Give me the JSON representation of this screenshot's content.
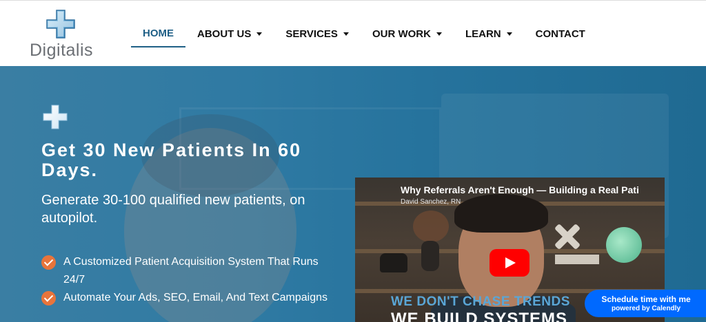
{
  "brand": {
    "name": "Digitalis",
    "accent": "#1e5f86",
    "cross_color": "#6fb2e0"
  },
  "nav": {
    "items": [
      {
        "label": "HOME",
        "active": true,
        "has_dropdown": false
      },
      {
        "label": "ABOUT US",
        "active": false,
        "has_dropdown": true
      },
      {
        "label": "SERVICES",
        "active": false,
        "has_dropdown": true
      },
      {
        "label": "OUR WORK",
        "active": false,
        "has_dropdown": true
      },
      {
        "label": "LEARN",
        "active": false,
        "has_dropdown": true
      },
      {
        "label": "CONTACT",
        "active": false,
        "has_dropdown": false
      }
    ]
  },
  "hero": {
    "title": "Get 30 New Patients In 60 Days.",
    "subtitle": "Generate 30-100 qualified new patients, on autopilot.",
    "benefits": [
      "A Customized Patient Acquisition System That Runs 24/7",
      "Automate Your Ads, SEO, Email, And Text Campaigns"
    ],
    "check_color": "#e8743b"
  },
  "video": {
    "title": "Why Referrals Aren't Enough — Building a Real Pati",
    "channel": "David Sanchez, RN",
    "banner_line1": "WE DON'T CHASE TRENDS",
    "banner_line2": "WE BUILD SYSTEMS",
    "play_color": "#ff0000"
  },
  "calendly": {
    "main": "Schedule time with me",
    "sub": "powered by Calendly",
    "color": "#0069ff"
  }
}
